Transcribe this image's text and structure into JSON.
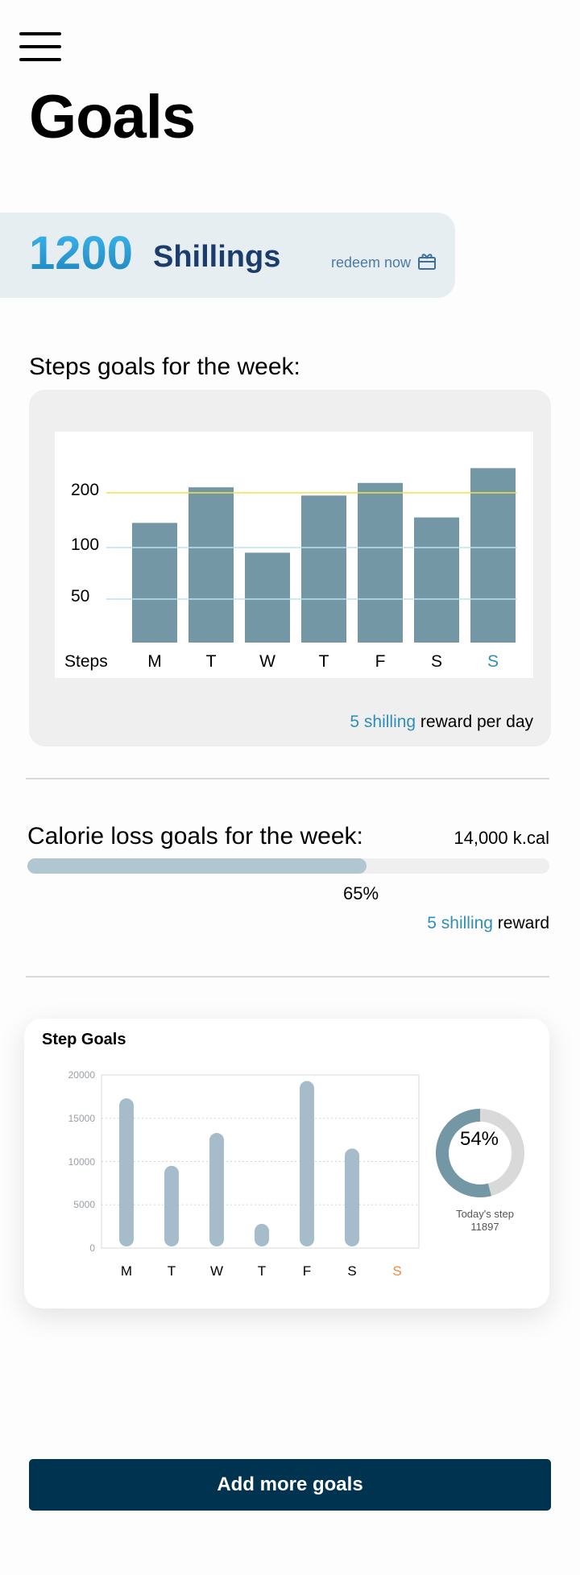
{
  "page": {
    "title": "Goals"
  },
  "balance": {
    "amount": "1200",
    "unit": "Shillings",
    "redeem_label": "redeem now"
  },
  "steps": {
    "title": "Steps goals for the week:",
    "axis_label": "Steps",
    "reward_highlight": "5 shilling",
    "reward_rest": " reward per day",
    "chart_data": {
      "type": "bar",
      "categories": [
        "M",
        "T",
        "W",
        "T",
        "F",
        "S",
        "S"
      ],
      "values": [
        145,
        210,
        95,
        195,
        218,
        155,
        245
      ],
      "y_ticks": [
        50,
        100,
        200
      ],
      "target_line": 200,
      "highlight_category_index": 6,
      "bar_color": "#7397a5",
      "target_color": "#f2e04a",
      "gridline_color": "#bde2ee",
      "highlight_color": "#2f8fb6"
    }
  },
  "calorie": {
    "title": "Calorie loss goals for the week:",
    "total": "14,000 k.cal",
    "progress": 0.65,
    "percent_label": "65%",
    "reward_highlight": "5 shilling",
    "reward_rest": " reward"
  },
  "step_goals": {
    "title": "Step Goals",
    "chart_data": {
      "type": "bar",
      "categories": [
        "M",
        "T",
        "W",
        "T",
        "F",
        "S",
        "S"
      ],
      "values": [
        17300,
        9500,
        13300,
        2800,
        19300,
        11500,
        0
      ],
      "y_ticks": [
        0,
        5000,
        10000,
        15000,
        20000
      ],
      "ylim": [
        0,
        20000
      ],
      "highlight_category_index": 6,
      "bar_color": "#a7bccb",
      "highlight_color": "#f0883e"
    },
    "today": {
      "percent": 0.54,
      "percent_label": "54%",
      "label": "Today's step",
      "steps": "11897",
      "ring_color": "#7397a5",
      "track_color": "#d9d9d9"
    }
  },
  "actions": {
    "add_label": "Add more goals"
  },
  "icons": {
    "menu": "hamburger-icon",
    "gift": "gift-icon"
  }
}
